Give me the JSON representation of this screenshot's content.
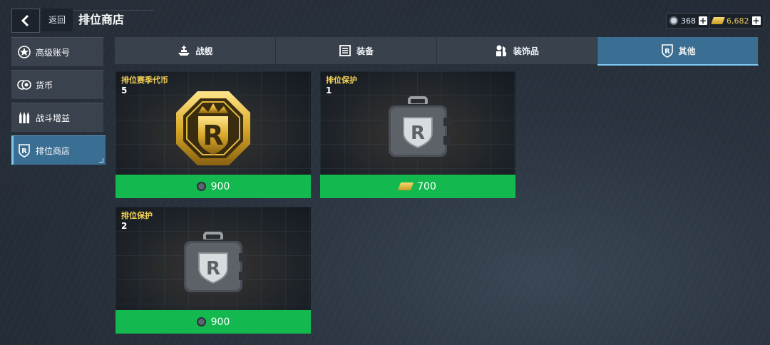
{
  "header": {
    "back_label": "返回",
    "title": "排位商店",
    "currencies": [
      {
        "name": "silver-coin",
        "value": "368"
      },
      {
        "name": "gold",
        "value": "6,682"
      }
    ]
  },
  "sidebar": {
    "items": [
      {
        "label": "高级账号",
        "icon": "star-badge-icon"
      },
      {
        "label": "货币",
        "icon": "coins-icon"
      },
      {
        "label": "战斗增益",
        "icon": "ammo-icon"
      },
      {
        "label": "排位商店",
        "icon": "ranked-shield-icon",
        "active": true
      }
    ]
  },
  "tabs": [
    {
      "label": "战舰",
      "icon": "warship-icon"
    },
    {
      "label": "装备",
      "icon": "equipment-icon"
    },
    {
      "label": "装饰品",
      "icon": "decoration-icon"
    },
    {
      "label": "其他",
      "icon": "ranked-shield-icon",
      "active": true
    }
  ],
  "items": [
    {
      "name": "排位赛季代币",
      "qty": "5",
      "price": "900",
      "currency": "silver-coin"
    },
    {
      "name": "排位保护",
      "qty": "1",
      "price": "700",
      "currency": "gold"
    },
    {
      "name": "排位保护",
      "qty": "2",
      "price": "900",
      "currency": "silver-coin"
    }
  ],
  "colors": {
    "accent": "#3b6e93",
    "buy_green": "#13b84e",
    "item_name": "#f0cf55",
    "gold_text": "#e8c65a"
  }
}
